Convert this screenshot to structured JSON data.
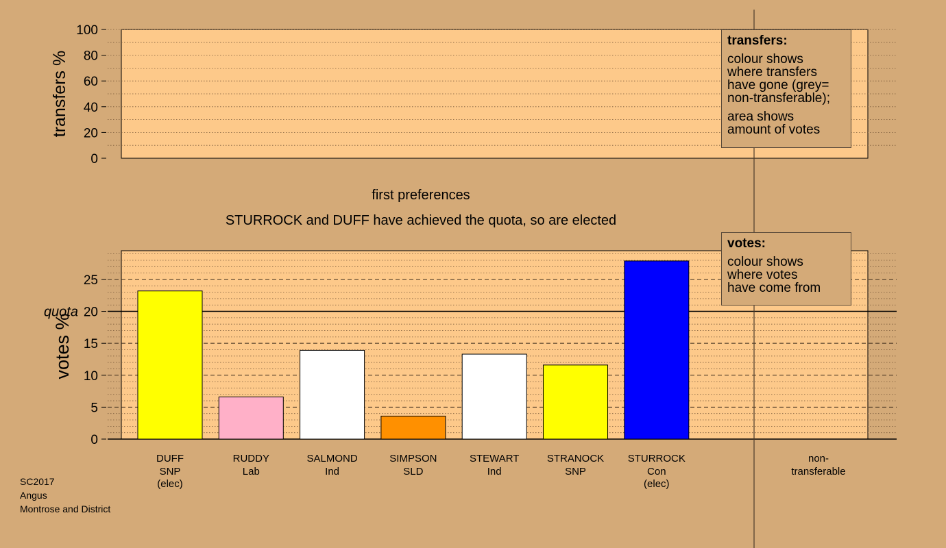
{
  "colors": {
    "background": "#d4aa78",
    "plot_background": "#fdc98a"
  },
  "chart_data": [
    {
      "type": "bar",
      "panel": "transfers",
      "ylabel": "transfers %",
      "ylim": [
        0,
        100
      ],
      "yticks": [
        0,
        20,
        40,
        60,
        80,
        100
      ],
      "series": [],
      "legend": {
        "title": "transfers:",
        "lines1": [
          "colour shows",
          "where transfers",
          "have gone (grey=",
          "non-transferable);"
        ],
        "lines2": [
          "area shows",
          "amount of votes"
        ]
      }
    },
    {
      "type": "bar",
      "panel": "votes",
      "title": "first preferences",
      "subtitle": "STURROCK and DUFF have achieved the quota, so are elected",
      "ylabel": "votes %",
      "ylim": [
        0,
        29.5
      ],
      "yticks": [
        0,
        5,
        10,
        15,
        20,
        25
      ],
      "quota": 20,
      "quota_label": "quota",
      "categories": [
        {
          "name": "DUFF",
          "party": "SNP",
          "status": "(elec)"
        },
        {
          "name": "RUDDY",
          "party": "Lab",
          "status": ""
        },
        {
          "name": "SALMOND",
          "party": "Ind",
          "status": ""
        },
        {
          "name": "SIMPSON",
          "party": "SLD",
          "status": ""
        },
        {
          "name": "STEWART",
          "party": "Ind",
          "status": ""
        },
        {
          "name": "STRANOCK",
          "party": "SNP",
          "status": ""
        },
        {
          "name": "STURROCK",
          "party": "Con",
          "status": "(elec)"
        }
      ],
      "values": [
        23.2,
        6.6,
        13.9,
        3.6,
        13.3,
        11.6,
        27.9
      ],
      "bar_colors": [
        "#ffff00",
        "#ffb0c8",
        "#ffffff",
        "#ff9000",
        "#ffffff",
        "#ffff00",
        "#0000ff"
      ],
      "nontransferable": {
        "line1": "non-",
        "line2": "transferable",
        "value": 0
      },
      "legend": {
        "title": "votes:",
        "lines": [
          "colour shows",
          "where votes",
          "have come from"
        ]
      }
    }
  ],
  "footer": {
    "code": "SC2017",
    "council": "Angus",
    "ward": "Montrose and District"
  }
}
